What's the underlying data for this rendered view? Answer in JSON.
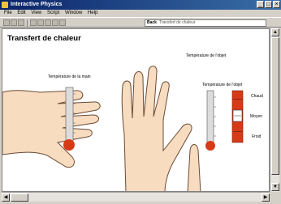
{
  "window": {
    "title": "Interactive Physics",
    "min": "_",
    "max": "□",
    "close": "×"
  },
  "menu": [
    "File",
    "Edit",
    "View",
    "Script",
    "Window",
    "Help"
  ],
  "toolbar": {
    "address_label": "Back",
    "address_value": "Transfert de chaleur"
  },
  "page": {
    "heading": "Transfert de chaleur",
    "object_temp_title": "Température de l'objet",
    "hand_temp_label": "Température de la main",
    "object_temp_label": "Température de l'objet",
    "levels": {
      "hot": "Chaud",
      "medium": "Moyen",
      "cold": "Froid"
    }
  },
  "colors": {
    "skin": "#f7dcc0",
    "skin_outline": "#6b4a33",
    "red": "#d63a16",
    "thermo": "#dcdcdc"
  }
}
